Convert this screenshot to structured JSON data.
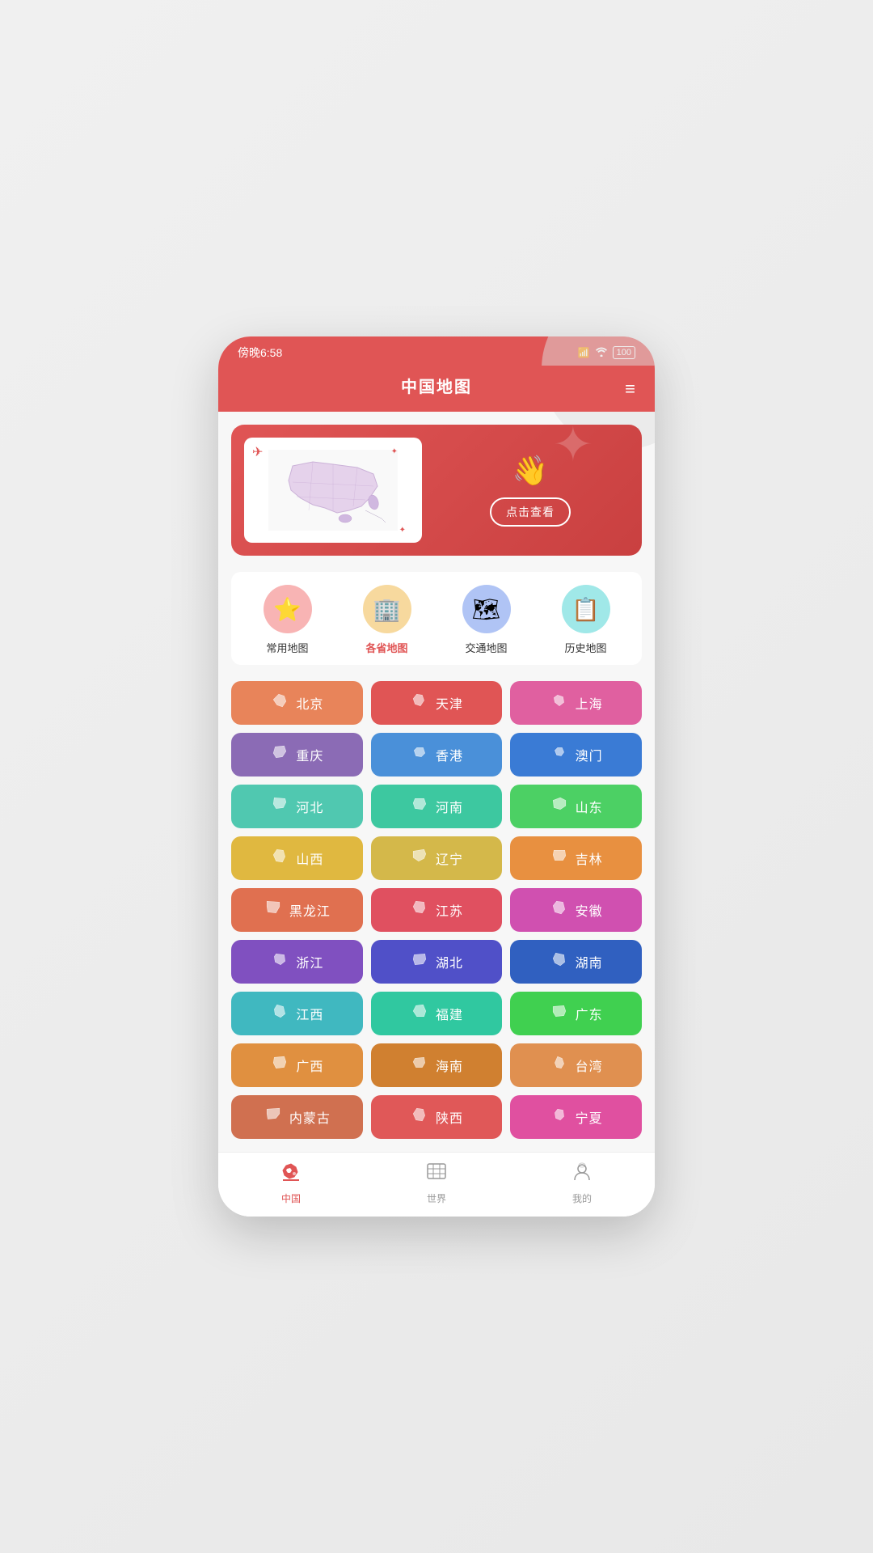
{
  "status_bar": {
    "time": "傍晚6:58",
    "signal": "▌▌▌",
    "wifi": "WiFi",
    "battery": "100"
  },
  "header": {
    "title": "中国地图",
    "menu_label": "≡"
  },
  "banner": {
    "click_label": "点击查看"
  },
  "categories": [
    {
      "id": "cat-common",
      "label": "常用地图",
      "icon": "⭐",
      "bg": "#f8b4b4",
      "active": false
    },
    {
      "id": "cat-province",
      "label": "各省地图",
      "icon": "🏙",
      "bg": "#f7d99e",
      "active": true
    },
    {
      "id": "cat-traffic",
      "label": "交通地图",
      "icon": "🗺",
      "bg": "#b0c4f5",
      "active": false
    },
    {
      "id": "cat-history",
      "label": "历史地图",
      "icon": "📋",
      "bg": "#a0e8e8",
      "active": false
    }
  ],
  "provinces": [
    {
      "name": "北京",
      "bg": "#e8845a"
    },
    {
      "name": "天津",
      "bg": "#e05555"
    },
    {
      "name": "上海",
      "bg": "#e060a0"
    },
    {
      "name": "重庆",
      "bg": "#8b6bb5"
    },
    {
      "name": "香港",
      "bg": "#4a90d9"
    },
    {
      "name": "澳门",
      "bg": "#3a7bd5"
    },
    {
      "name": "河北",
      "bg": "#50c8b0"
    },
    {
      "name": "河南",
      "bg": "#3dc8a0"
    },
    {
      "name": "山东",
      "bg": "#4cd064"
    },
    {
      "name": "山西",
      "bg": "#e0b840"
    },
    {
      "name": "辽宁",
      "bg": "#d4b84a"
    },
    {
      "name": "吉林",
      "bg": "#e89040"
    },
    {
      "name": "黑龙江",
      "bg": "#e07050"
    },
    {
      "name": "江苏",
      "bg": "#e05060"
    },
    {
      "name": "安徽",
      "bg": "#d050b0"
    },
    {
      "name": "浙江",
      "bg": "#8050c0"
    },
    {
      "name": "湖北",
      "bg": "#5050c8"
    },
    {
      "name": "湖南",
      "bg": "#3060c0"
    },
    {
      "name": "江西",
      "bg": "#40b8c0"
    },
    {
      "name": "福建",
      "bg": "#30c8a0"
    },
    {
      "name": "广东",
      "bg": "#40d050"
    },
    {
      "name": "广西",
      "bg": "#e09040"
    },
    {
      "name": "海南",
      "bg": "#d08030"
    },
    {
      "name": "台湾",
      "bg": "#e09050"
    },
    {
      "name": "内蒙古",
      "bg": "#d07050"
    },
    {
      "name": "陕西",
      "bg": "#e05858"
    },
    {
      "name": "宁夏",
      "bg": "#e050a0"
    }
  ],
  "bottom_nav": [
    {
      "id": "nav-china",
      "label": "中国",
      "icon": "❤",
      "active": true
    },
    {
      "id": "nav-world",
      "label": "世界",
      "icon": "🌍",
      "active": false
    },
    {
      "id": "nav-mine",
      "label": "我的",
      "icon": "👤",
      "active": false
    }
  ]
}
